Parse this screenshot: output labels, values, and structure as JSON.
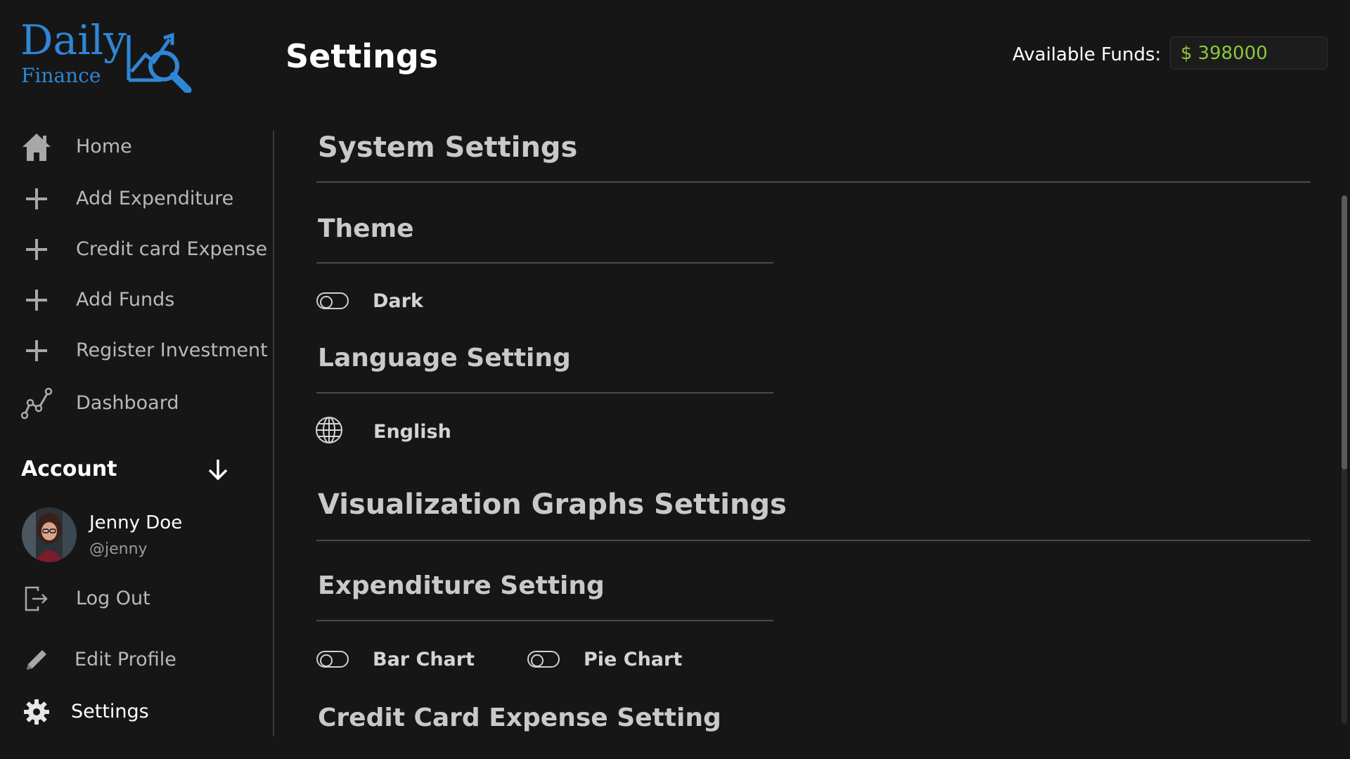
{
  "brand": {
    "name": "Daily",
    "sub": "Finance",
    "color": "#2f86d6"
  },
  "header": {
    "title": "Settings",
    "funds_label": "Available Funds:",
    "funds_symbol": "$",
    "funds_value": "398000",
    "funds_color": "#8cc63f"
  },
  "sidebar": {
    "items": [
      {
        "label": "Home",
        "icon": "home-icon"
      },
      {
        "label": "Add Expenditure",
        "icon": "plus-icon"
      },
      {
        "label": "Credit card Expense",
        "icon": "plus-icon"
      },
      {
        "label": "Add Funds",
        "icon": "plus-icon"
      },
      {
        "label": "Register Investment",
        "icon": "plus-icon"
      },
      {
        "label": "Dashboard",
        "icon": "line-chart-icon"
      }
    ],
    "account": {
      "title": "Account",
      "name": "Jenny Doe",
      "handle": "@jenny",
      "logout": "Log Out",
      "edit_profile": "Edit Profile",
      "settings": "Settings"
    }
  },
  "main": {
    "system_settings": "System Settings",
    "theme": {
      "title": "Theme",
      "option": "Dark",
      "enabled": false
    },
    "language": {
      "title": "Language Setting",
      "value": "English"
    },
    "viz_settings": "Visualization Graphs Settings",
    "expenditure": {
      "title": "Expenditure Setting",
      "bar_chart": "Bar Chart",
      "pie_chart": "Pie Chart",
      "bar_enabled": false,
      "pie_enabled": false
    },
    "credit_card": {
      "title": "Credit Card Expense Setting"
    }
  }
}
